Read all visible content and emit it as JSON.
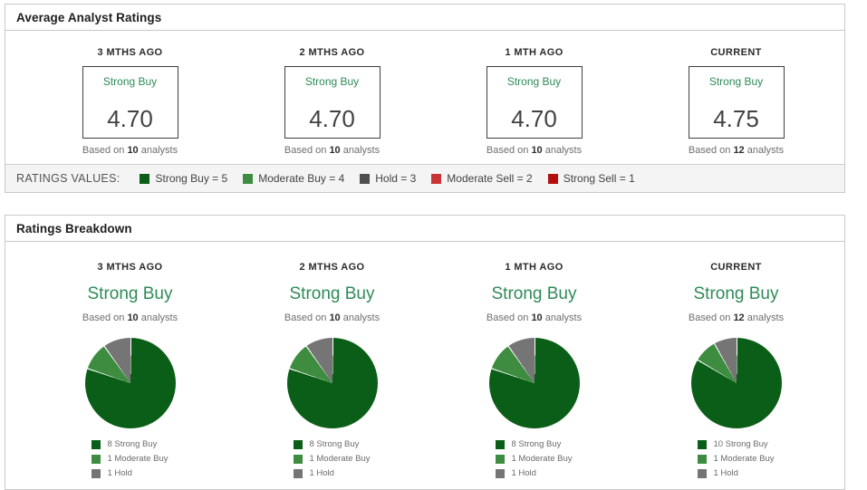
{
  "colors": {
    "rating_text_green": "#2e8b57",
    "strong_buy": "#0b5e17",
    "moderate_buy": "#3e8c40",
    "hold_pie": "#757575",
    "hold_legend": "#4f4f4f",
    "moderate_sell": "#cb3434",
    "strong_sell": "#b30f0f",
    "panel_border": "#c9c9c9",
    "legend_bar_bg": "#f4f4f4"
  },
  "average_panel": {
    "title": "Average Analyst Ratings",
    "columns": [
      {
        "period": "3 MTHS AGO",
        "rating": "Strong Buy",
        "value": "4.70",
        "based_prefix": "Based on",
        "analysts": "10",
        "based_suffix": "analysts"
      },
      {
        "period": "2 MTHS AGO",
        "rating": "Strong Buy",
        "value": "4.70",
        "based_prefix": "Based on",
        "analysts": "10",
        "based_suffix": "analysts"
      },
      {
        "period": "1 MTH AGO",
        "rating": "Strong Buy",
        "value": "4.70",
        "based_prefix": "Based on",
        "analysts": "10",
        "based_suffix": "analysts"
      },
      {
        "period": "CURRENT",
        "rating": "Strong Buy",
        "value": "4.75",
        "based_prefix": "Based on",
        "analysts": "12",
        "based_suffix": "analysts"
      }
    ],
    "legend_label": "RATINGS VALUES:",
    "legend": [
      {
        "label": "Strong Buy = 5",
        "color": "#0b5e17"
      },
      {
        "label": "Moderate Buy = 4",
        "color": "#3e8c40"
      },
      {
        "label": "Hold = 3",
        "color": "#4f4f4f"
      },
      {
        "label": "Moderate Sell = 2",
        "color": "#cb3434"
      },
      {
        "label": "Strong Sell = 1",
        "color": "#b30f0f"
      }
    ]
  },
  "breakdown_panel": {
    "title": "Ratings Breakdown"
  },
  "chart_data": [
    {
      "type": "pie",
      "title": "3 MTHS AGO",
      "rating": "Strong Buy",
      "based_prefix": "Based on",
      "analysts": "10",
      "based_suffix": "analysts",
      "labels": [
        "Strong Buy",
        "Moderate Buy",
        "Hold"
      ],
      "values": [
        8,
        1,
        1
      ],
      "colors": [
        "#0b5e17",
        "#3e8c40",
        "#757575"
      ],
      "legend_items": [
        "8 Strong Buy",
        "1 Moderate Buy",
        "1 Hold"
      ],
      "start_angle_deg": 0,
      "direction": "clockwise",
      "legend_position": "bottom"
    },
    {
      "type": "pie",
      "title": "2 MTHS AGO",
      "rating": "Strong Buy",
      "based_prefix": "Based on",
      "analysts": "10",
      "based_suffix": "analysts",
      "labels": [
        "Strong Buy",
        "Moderate Buy",
        "Hold"
      ],
      "values": [
        8,
        1,
        1
      ],
      "colors": [
        "#0b5e17",
        "#3e8c40",
        "#757575"
      ],
      "legend_items": [
        "8 Strong Buy",
        "1 Moderate Buy",
        "1 Hold"
      ],
      "start_angle_deg": 0,
      "direction": "clockwise",
      "legend_position": "bottom"
    },
    {
      "type": "pie",
      "title": "1 MTH AGO",
      "rating": "Strong Buy",
      "based_prefix": "Based on",
      "analysts": "10",
      "based_suffix": "analysts",
      "labels": [
        "Strong Buy",
        "Moderate Buy",
        "Hold"
      ],
      "values": [
        8,
        1,
        1
      ],
      "colors": [
        "#0b5e17",
        "#3e8c40",
        "#757575"
      ],
      "legend_items": [
        "8 Strong Buy",
        "1 Moderate Buy",
        "1 Hold"
      ],
      "start_angle_deg": 0,
      "direction": "clockwise",
      "legend_position": "bottom"
    },
    {
      "type": "pie",
      "title": "CURRENT",
      "rating": "Strong Buy",
      "based_prefix": "Based on",
      "analysts": "12",
      "based_suffix": "analysts",
      "labels": [
        "Strong Buy",
        "Moderate Buy",
        "Hold"
      ],
      "values": [
        10,
        1,
        1
      ],
      "colors": [
        "#0b5e17",
        "#3e8c40",
        "#757575"
      ],
      "legend_items": [
        "10 Strong Buy",
        "1 Moderate Buy",
        "1 Hold"
      ],
      "start_angle_deg": 0,
      "direction": "clockwise",
      "legend_position": "bottom"
    }
  ]
}
